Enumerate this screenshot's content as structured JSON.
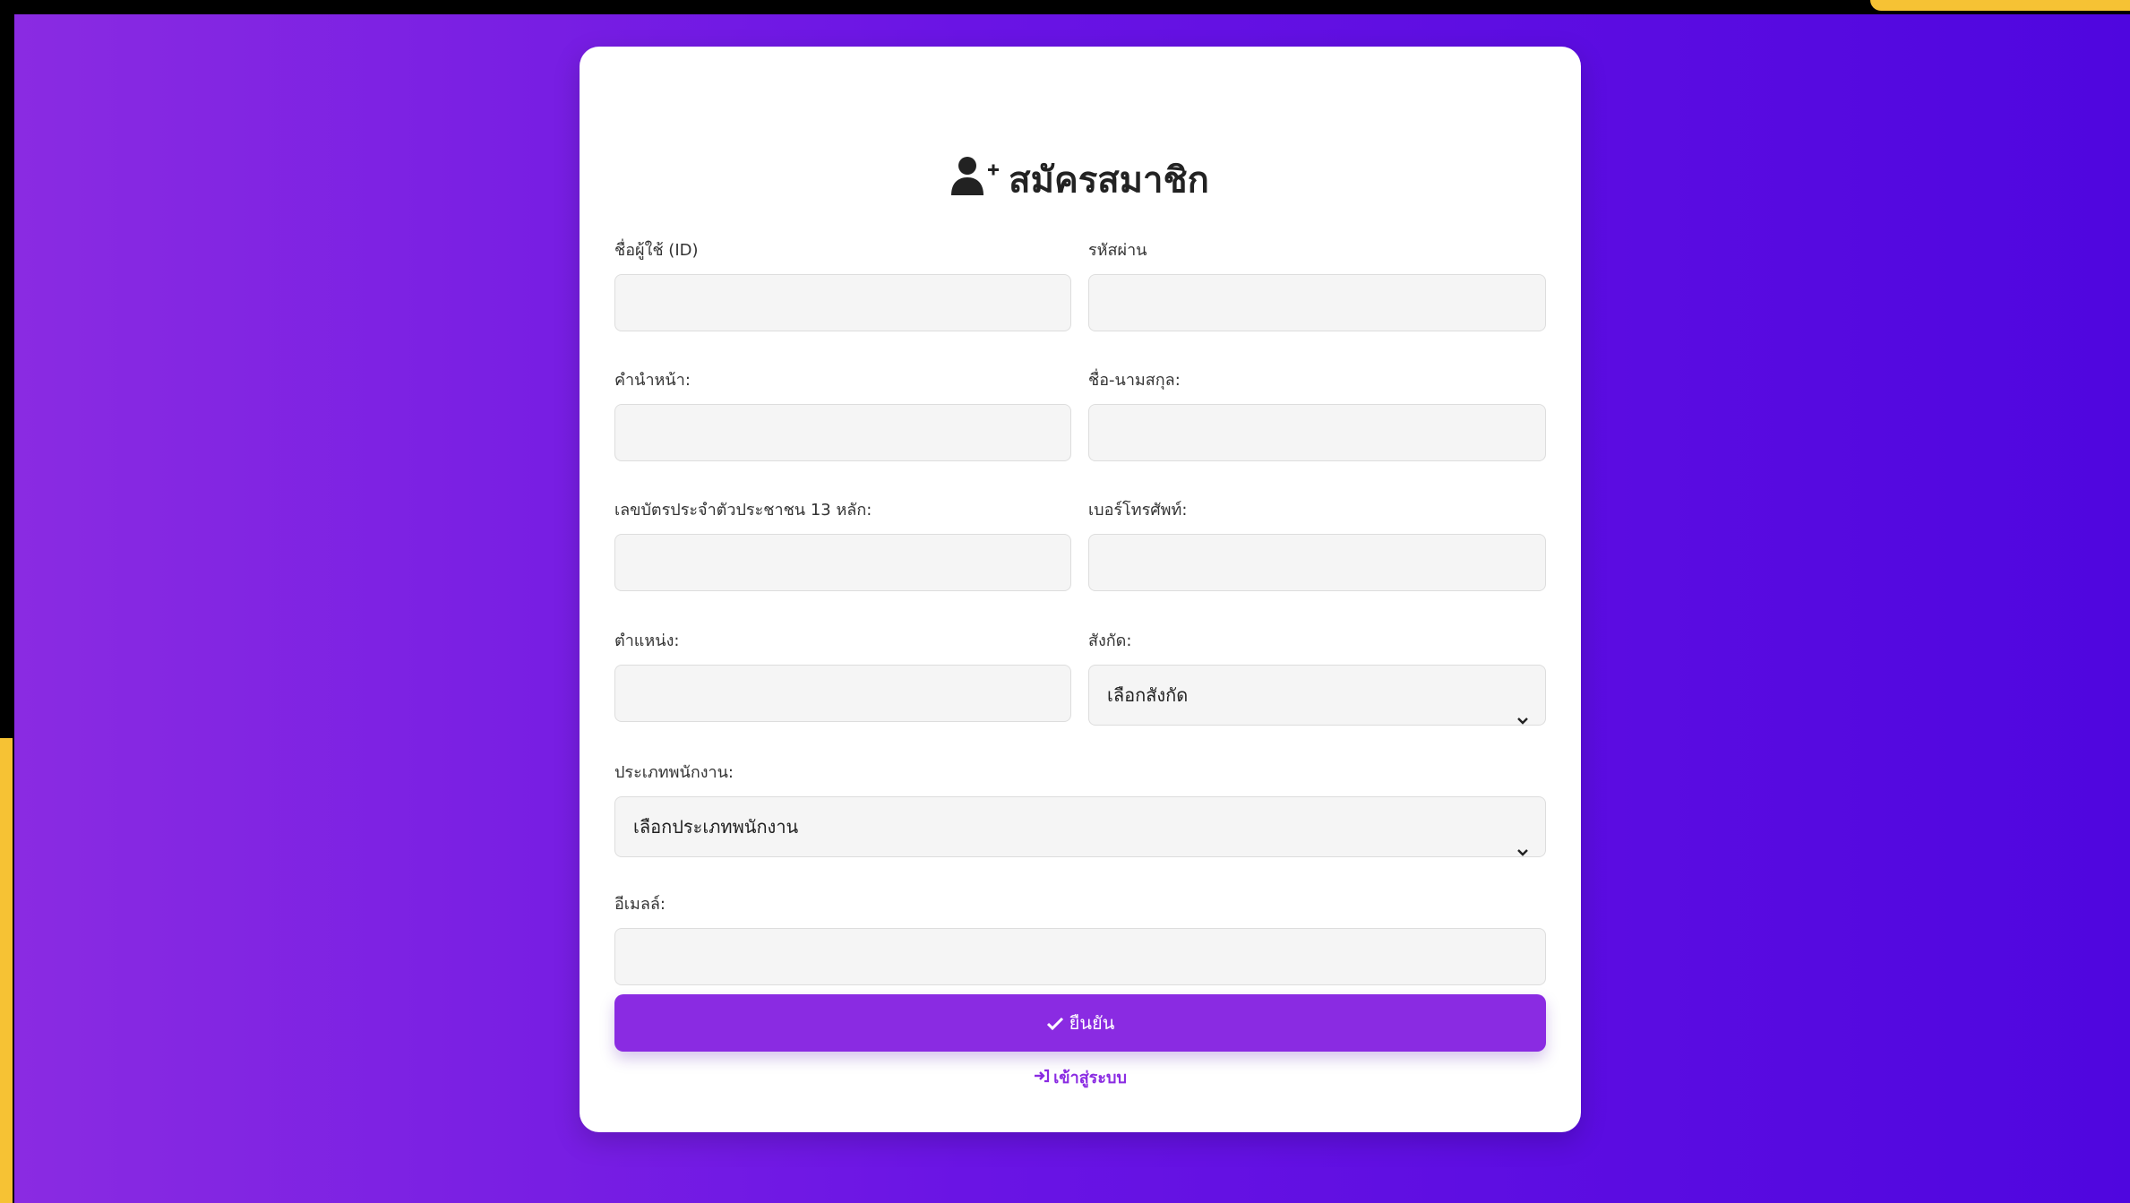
{
  "page": {
    "title": "สมัครสมาชิก",
    "accent_color": "#8a2be2",
    "highlight_color": "#f6c234"
  },
  "fields": {
    "username": {
      "label": "ชื่อผู้ใช้ (ID)",
      "value": ""
    },
    "password": {
      "label": "รหัสผ่าน",
      "value": ""
    },
    "prefix": {
      "label": "คำนำหน้า:",
      "value": ""
    },
    "fullname": {
      "label": "ชื่อ-นามสกุล:",
      "value": ""
    },
    "citizen_id": {
      "label": "เลขบัตรประจำตัวประชาชน 13 หลัก:",
      "value": ""
    },
    "phone": {
      "label": "เบอร์โทรศัพท์:",
      "value": ""
    },
    "position": {
      "label": "ตำแหน่ง:",
      "value": ""
    },
    "affiliation": {
      "label": "สังกัด:",
      "selected": "เลือกสังกัด"
    },
    "employee_type": {
      "label": "ประเภทพนักงาน:",
      "selected": "เลือกประเภทพนักงาน"
    },
    "email": {
      "label": "อีเมลล์:",
      "value": ""
    }
  },
  "actions": {
    "submit_label": "ยืนยัน",
    "login_link": "เข้าสู่ระบบ"
  }
}
